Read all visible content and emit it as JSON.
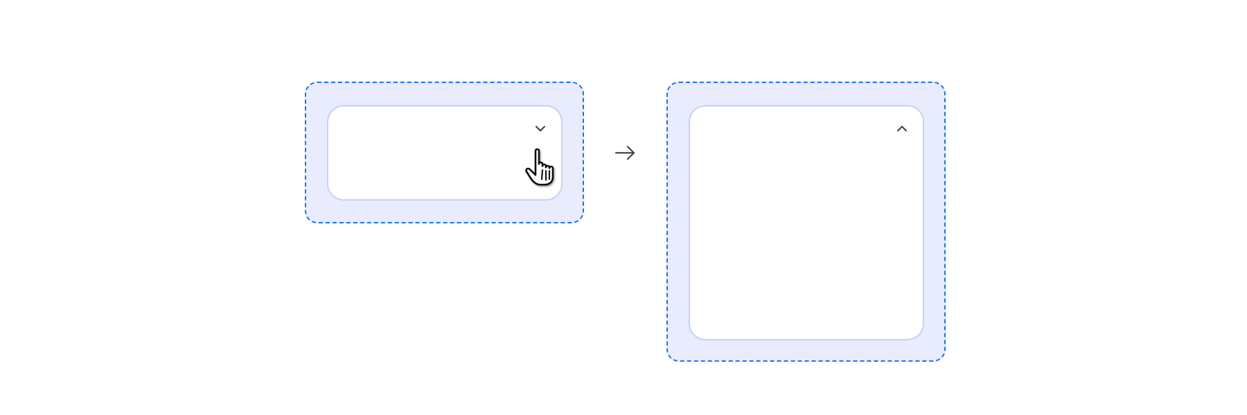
{
  "diagram": {
    "states": [
      {
        "id": "collapsed",
        "toggle_icon": "chevron-down-icon"
      },
      {
        "id": "expanded",
        "toggle_icon": "chevron-up-icon"
      }
    ],
    "transition_icon": "arrow-right-icon",
    "pointer_icon": "hand-cursor-icon",
    "colors": {
      "frame_border": "#1a73e8",
      "frame_fill": "#e8ecfd",
      "card_border": "#c9cff5",
      "card_fill": "#ffffff",
      "icon": "#444444"
    }
  }
}
